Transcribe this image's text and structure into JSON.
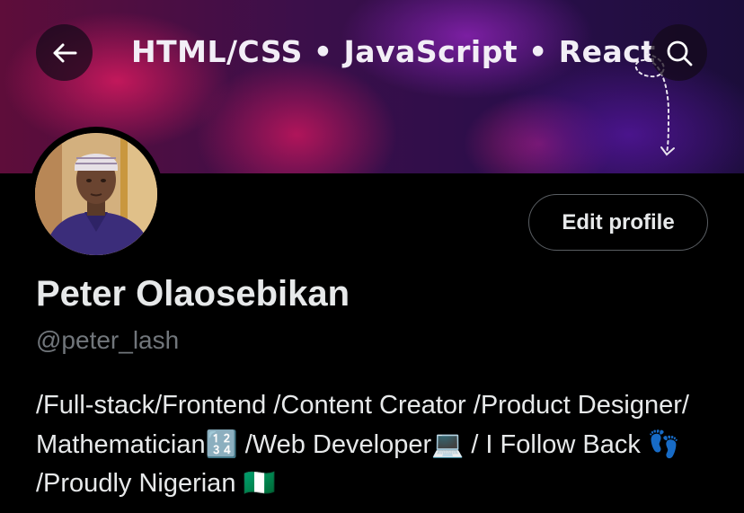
{
  "header": {
    "banner_text": "HTML/CSS • JavaScript • React",
    "back_icon": "arrow-left-icon",
    "search_icon": "search-icon"
  },
  "profile": {
    "edit_label": "Edit profile",
    "name": "Peter Olaosebikan",
    "handle": "@peter_lash",
    "bio": "/Full-stack/Frontend /Content Creator /Product Designer/ Mathematician🔢 /Web Developer💻 / I Follow Back 👣 /Proudly Nigerian 🇳🇬"
  },
  "colors": {
    "background": "#000000",
    "text_primary": "#e7e9ea",
    "text_secondary": "#71767b",
    "button_border": "#5a5e63"
  }
}
